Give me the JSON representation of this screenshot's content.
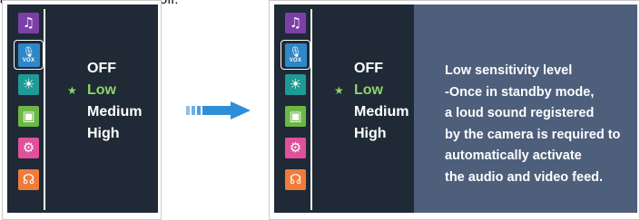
{
  "caption": "a the LCD screen will turn off.",
  "sidebar_icons": [
    {
      "name": "music-icon",
      "glyph": "♫",
      "color": "#7c3fa8"
    },
    {
      "name": "vox-microphone-icon",
      "glyph": "🎙",
      "label": "VOX",
      "color": "#2f87c8"
    },
    {
      "name": "brightness-icon",
      "glyph": "☀",
      "color": "#1f9a95"
    },
    {
      "name": "camera-icon",
      "glyph": "▣",
      "color": "#6db845"
    },
    {
      "name": "settings-gear-icon",
      "glyph": "⚙",
      "color": "#e0509b"
    },
    {
      "name": "headset-icon",
      "glyph": "☊",
      "color": "#ef7c3b"
    }
  ],
  "menu": {
    "options": [
      "OFF",
      "Low",
      "Medium",
      "High"
    ],
    "selected": "Low",
    "selected_marker": "★",
    "selected_color": "#8fd36b"
  },
  "info": {
    "lines": [
      "Low sensitivity level",
      "-Once in standby mode,",
      "a loud sound registered",
      "by the camera is required to",
      "automatically activate",
      "the audio and video feed."
    ]
  },
  "arrow": {
    "color": "#2e8fd8"
  }
}
